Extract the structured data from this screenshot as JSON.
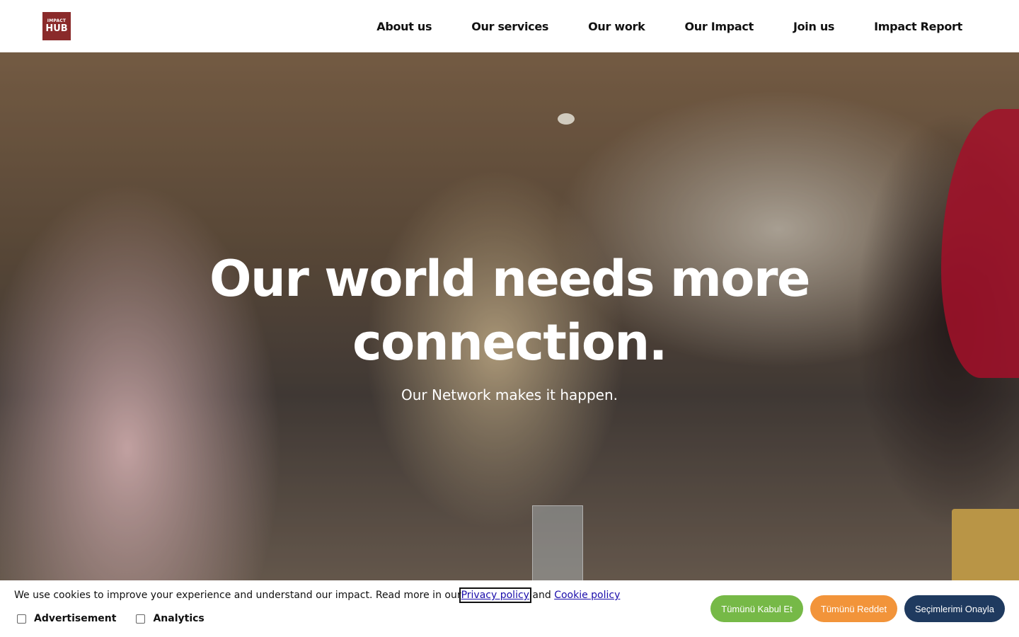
{
  "logo": {
    "line1": "IMPACT",
    "line2": "HUB"
  },
  "nav": {
    "items": [
      "About us",
      "Our services",
      "Our work",
      "Our Impact",
      "Join us",
      "Impact Report"
    ]
  },
  "hero": {
    "headline": "Our world needs more connection.",
    "subline": "Our Network makes it happen."
  },
  "cookie": {
    "text": "We use cookies to improve your experience and understand our impact. Read more in our",
    "privacy_link": "Privacy policy",
    "and_text": "and",
    "cookie_link": "Cookie policy",
    "options": [
      "Advertisement",
      "Analytics"
    ],
    "accept_label": "Tümünü Kabul Et",
    "reject_label": "Tümünü Reddet",
    "confirm_label": "Seçimlerimi Onayla"
  },
  "colors": {
    "logo_bg": "#8a2a2a",
    "accept": "#76b947",
    "reject": "#f2943a",
    "confirm": "#1f3a5f"
  }
}
